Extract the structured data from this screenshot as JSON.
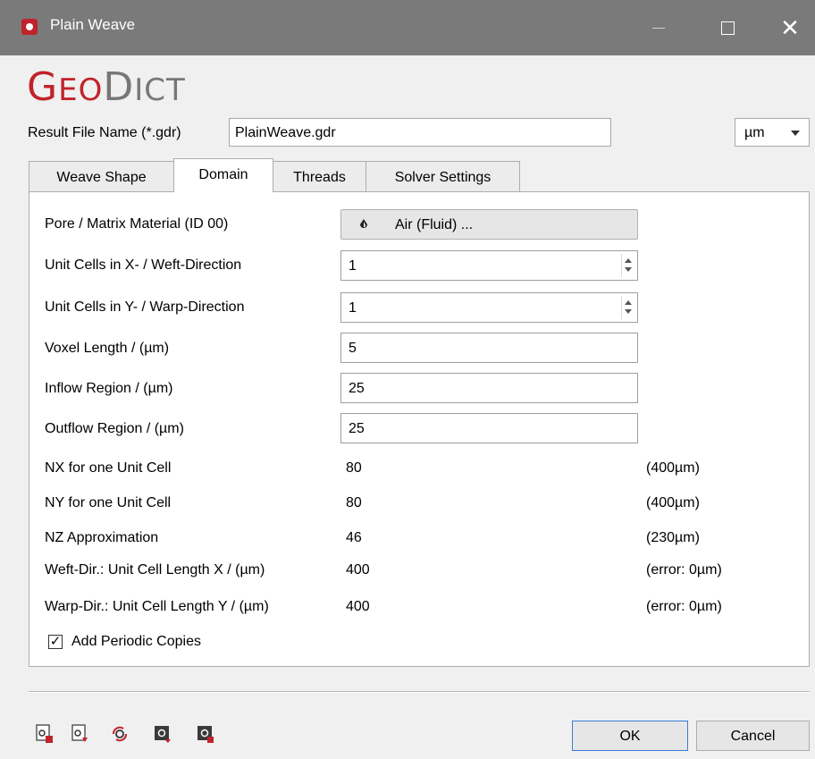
{
  "window": {
    "title": "Plain Weave"
  },
  "logo": {
    "text_geo_g": "G",
    "text_geo_rest": "EO",
    "text_dict_d": "D",
    "text_dict_rest": "ICT"
  },
  "result_file": {
    "label": "Result File Name (*.gdr)",
    "value": "PlainWeave.gdr"
  },
  "unit_select": {
    "value": "µm"
  },
  "tabs": [
    {
      "label": "Weave Shape",
      "active": false
    },
    {
      "label": "Domain",
      "active": true
    },
    {
      "label": "Threads",
      "active": false
    },
    {
      "label": "Solver Settings",
      "active": false
    }
  ],
  "domain": {
    "material": {
      "label": "Pore / Matrix Material (ID 00)",
      "button": "Air (Fluid) ..."
    },
    "unit_cells_x": {
      "label": "Unit Cells in X- / Weft-Direction",
      "value": "1"
    },
    "unit_cells_y": {
      "label": "Unit Cells in Y- / Warp-Direction",
      "value": "1"
    },
    "voxel_length": {
      "label": "Voxel Length / (µm)",
      "value": "5"
    },
    "inflow": {
      "label": "Inflow Region / (µm)",
      "value": "25"
    },
    "outflow": {
      "label": "Outflow Region / (µm)",
      "value": "25"
    },
    "nx": {
      "label": "NX for one Unit Cell",
      "value": "80",
      "extra": "(400µm)"
    },
    "ny": {
      "label": "NY for one Unit Cell",
      "value": "80",
      "extra": "(400µm)"
    },
    "nz": {
      "label": "NZ Approximation",
      "value": "46",
      "extra": "(230µm)"
    },
    "weft_len": {
      "label": "Weft-Dir.: Unit Cell Length X / (µm)",
      "value": "400",
      "extra": "(error: 0µm)"
    },
    "warp_len": {
      "label": "Warp-Dir.: Unit Cell Length Y / (µm)",
      "value": "400",
      "extra": "(error: 0µm)"
    },
    "periodic": {
      "label": "Add Periodic Copies",
      "checked": true,
      "mark": "✓"
    }
  },
  "footer": {
    "icons": [
      "load-settings-icon",
      "save-settings-icon",
      "reset-settings-icon",
      "macro-record-icon",
      "export-settings-icon"
    ],
    "ok_label": "OK",
    "cancel_label": "Cancel"
  },
  "colors": {
    "brand": "#c0232b",
    "titlebar": "#7a7a7a"
  }
}
